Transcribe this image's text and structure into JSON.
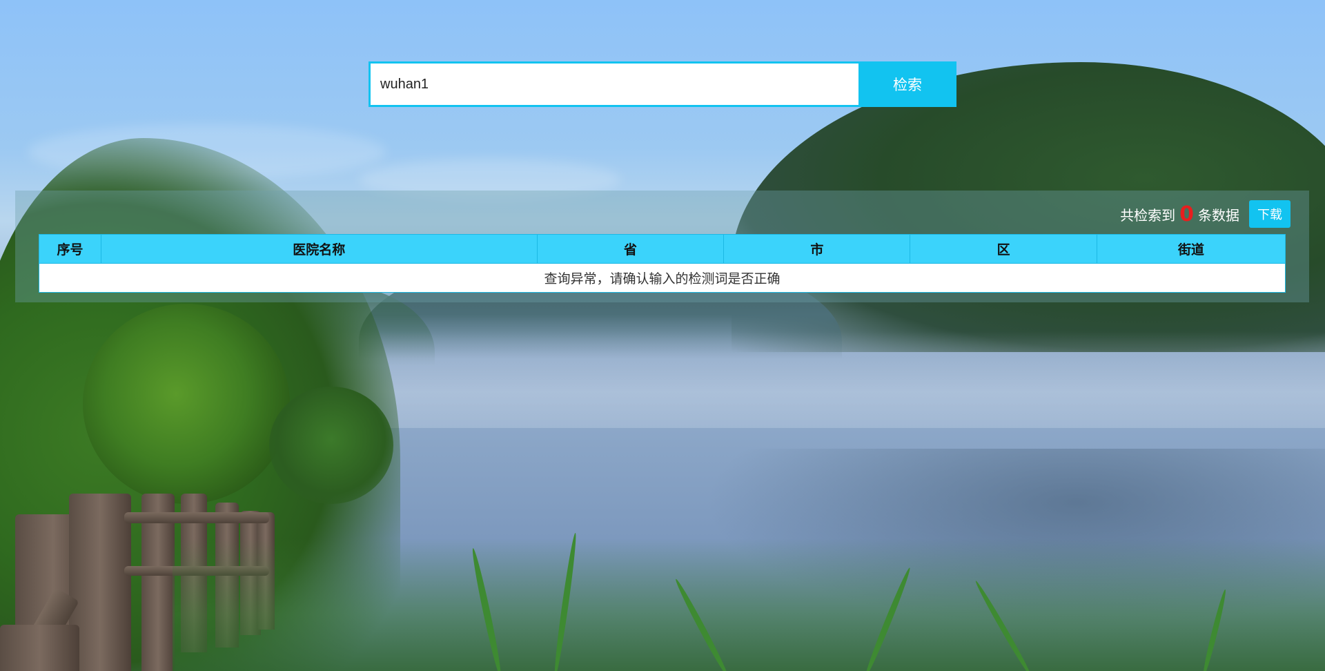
{
  "search": {
    "value": "wuhan1",
    "button_label": "检索"
  },
  "summary": {
    "prefix": "共检索到",
    "count": "0",
    "suffix": "条数据",
    "download_label": "下载"
  },
  "table": {
    "headers": [
      "序号",
      "医院名称",
      "省",
      "市",
      "区",
      "街道"
    ],
    "message": "查询异常，请确认输入的检测词是否正确"
  },
  "colors": {
    "accent": "#12c3f0",
    "header_bg": "#3bd3fb",
    "count": "#e81e1e"
  }
}
